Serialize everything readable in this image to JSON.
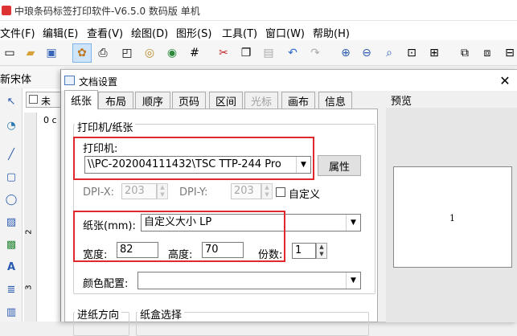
{
  "app": {
    "title": "中琅条码标签打印软件-V6.5.0 数码版 单机"
  },
  "menu": [
    "文件(F)",
    "编辑(E)",
    "查看(V)",
    "绘图(D)",
    "图形(S)",
    "工具(T)",
    "窗口(W)",
    "帮助(H)"
  ],
  "font_name": "新宋体",
  "doc_tab": "未",
  "canvas_label": "0 c",
  "ruler_marks": [
    "2",
    "3"
  ],
  "dialog": {
    "title": "文档设置",
    "close": "✕",
    "tabs": [
      "纸张",
      "布局",
      "顺序",
      "页码",
      "区间",
      "光标",
      "画布",
      "信息"
    ],
    "active_tab": "纸张",
    "disabled_tab": "光标",
    "group_title": "打印机/纸张",
    "printer_label": "打印机:",
    "printer_value": "\\\\PC-202004111432\\TSC TTP-244 Pro",
    "properties_button": "属性",
    "dpi_x_label": "DPI-X:",
    "dpi_x_value": "203",
    "dpi_y_label": "DPI-Y:",
    "dpi_y_value": "203",
    "custom_label": "自定义",
    "paper_label": "纸张(mm):",
    "paper_value": "自定义大小 LP",
    "width_label": "宽度:",
    "width_value": "82",
    "height_label": "高度:",
    "height_value": "70",
    "copies_label": "份数:",
    "copies_value": "1",
    "color_label": "颜色配置:",
    "color_value": "",
    "feed_label": "进纸方向",
    "tray_label": "纸盒选择",
    "preview_label": "预览",
    "preview_page_number": "1"
  },
  "colors": {
    "highlight": "#e0282e",
    "accent": "#cde4fb"
  }
}
